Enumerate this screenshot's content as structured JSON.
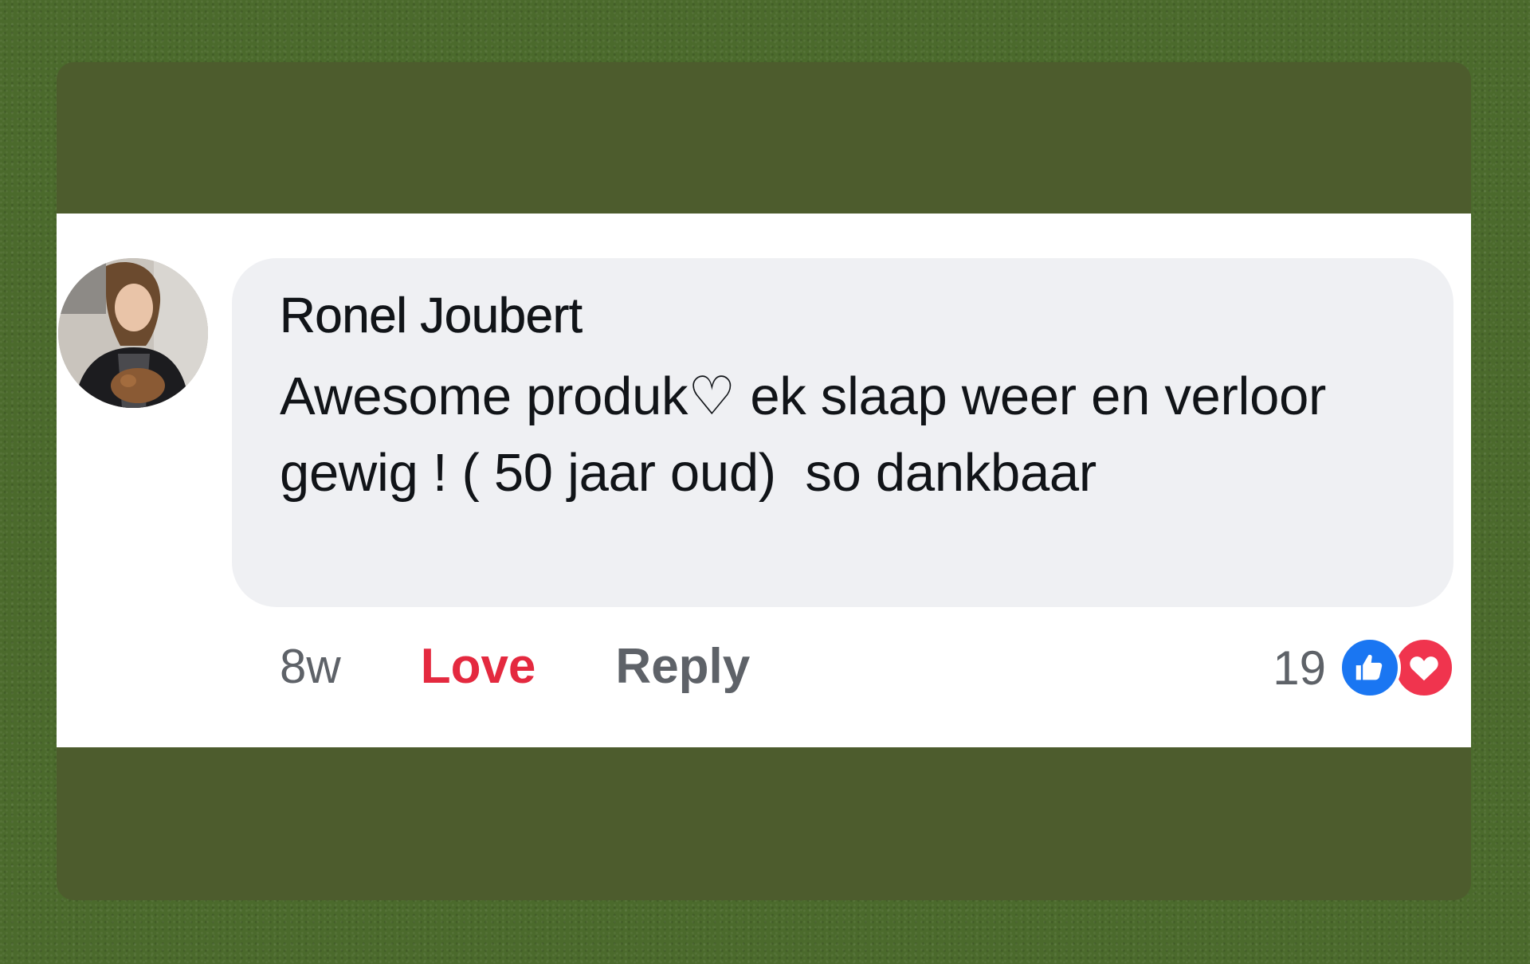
{
  "comment": {
    "author": "Ronel Joubert",
    "text": "Awesome produk♡ ek slaap weer en verloor gewig ! ( 50 jaar oud)  so dankbaar",
    "avatar": "profile-photo",
    "timestamp": "8w",
    "actions": {
      "love_label": "Love",
      "reply_label": "Reply"
    },
    "reactions": {
      "count": "19",
      "icons": [
        "like-icon",
        "love-icon"
      ]
    }
  },
  "colors": {
    "love_active": "#e4293f",
    "like_blue": "#1a76f2",
    "love_red": "#f0344e",
    "bubble_bg": "#eff0f3",
    "page_green": "#4d5c2d"
  }
}
